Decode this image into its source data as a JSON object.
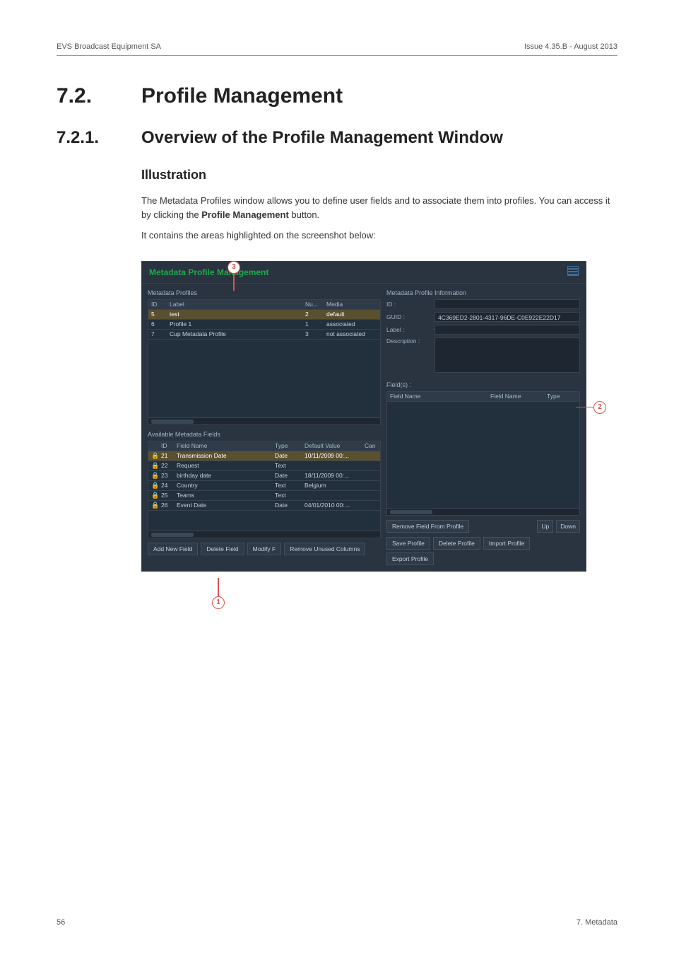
{
  "header": {
    "left": "EVS Broadcast Equipment SA",
    "right": "Issue 4.35.B - August 2013"
  },
  "section": {
    "num": "7.2.",
    "title": "Profile Management"
  },
  "subsection": {
    "num": "7.2.1.",
    "title": "Overview of the Profile Management Window"
  },
  "illustration_heading": "Illustration",
  "para1_a": "The Metadata Profiles window allows you to define user fields and to associate them into profiles. You can access it by clicking the ",
  "para1_bold": "Profile Management",
  "para1_b": " button.",
  "para2": "It contains the areas highlighted on the screenshot below:",
  "callouts": {
    "c1": "1",
    "c2": "2",
    "c3": "3"
  },
  "window": {
    "title": "Metadata Profile Management",
    "profiles": {
      "label": "Metadata Profiles",
      "headers": {
        "id": "ID",
        "label": "Label",
        "nu": "Nu...",
        "media": "Media"
      },
      "rows": [
        {
          "id": "5",
          "label": "test",
          "nu": "2",
          "media": "default",
          "sel": true
        },
        {
          "id": "6",
          "label": "Profile 1",
          "nu": "1",
          "media": "associated"
        },
        {
          "id": "7",
          "label": "Cup Metadata Profile",
          "nu": "3",
          "media": "not associated"
        }
      ]
    },
    "fields": {
      "label": "Available Metadata Fields",
      "headers": {
        "id": "ID",
        "name": "Field Name",
        "type": "Type",
        "def": "Default Value",
        "can": "Can"
      },
      "rows": [
        {
          "lock": true,
          "id": "21",
          "name": "Transmission Date",
          "type": "Date",
          "def": "10/11/2009 00:...",
          "sel": true
        },
        {
          "lock": true,
          "id": "22",
          "name": "Request",
          "type": "Text",
          "def": ""
        },
        {
          "lock": true,
          "id": "23",
          "name": "birthday date",
          "type": "Date",
          "def": "18/11/2009 00:..."
        },
        {
          "lock": true,
          "id": "24",
          "name": "Country",
          "type": "Text",
          "def": "Belgium"
        },
        {
          "lock": true,
          "id": "25",
          "name": "Teams",
          "type": "Text",
          "def": ""
        },
        {
          "lock": true,
          "id": "26",
          "name": "Event Date",
          "type": "Date",
          "def": "04/01/2010 00:..."
        }
      ]
    },
    "info": {
      "label": "Metadata Profile Information",
      "id_label": "ID :",
      "guid_label": "GUID :",
      "guid_value": "4C369ED2-2801-4317-96DE-C0E922E22D17",
      "label_label": "Label :",
      "desc_label": "Description :",
      "fields_label": "Field(s) :",
      "assigned_headers": {
        "name1": "Field Name",
        "name2": "Field Name",
        "type": "Type"
      }
    },
    "buttons": {
      "add_new_field": "Add New Field",
      "delete_field": "Delete Field",
      "modify_f": "Modify F",
      "remove_unused": "Remove Unused Columns",
      "remove_from_profile": "Remove Field From Profile",
      "up": "Up",
      "down": "Down",
      "save_profile": "Save Profile",
      "delete_profile": "Delete Profile",
      "import_profile": "Import Profile",
      "export_profile": "Export Profile"
    }
  },
  "footer": {
    "left": "56",
    "right": "7. Metadata"
  }
}
